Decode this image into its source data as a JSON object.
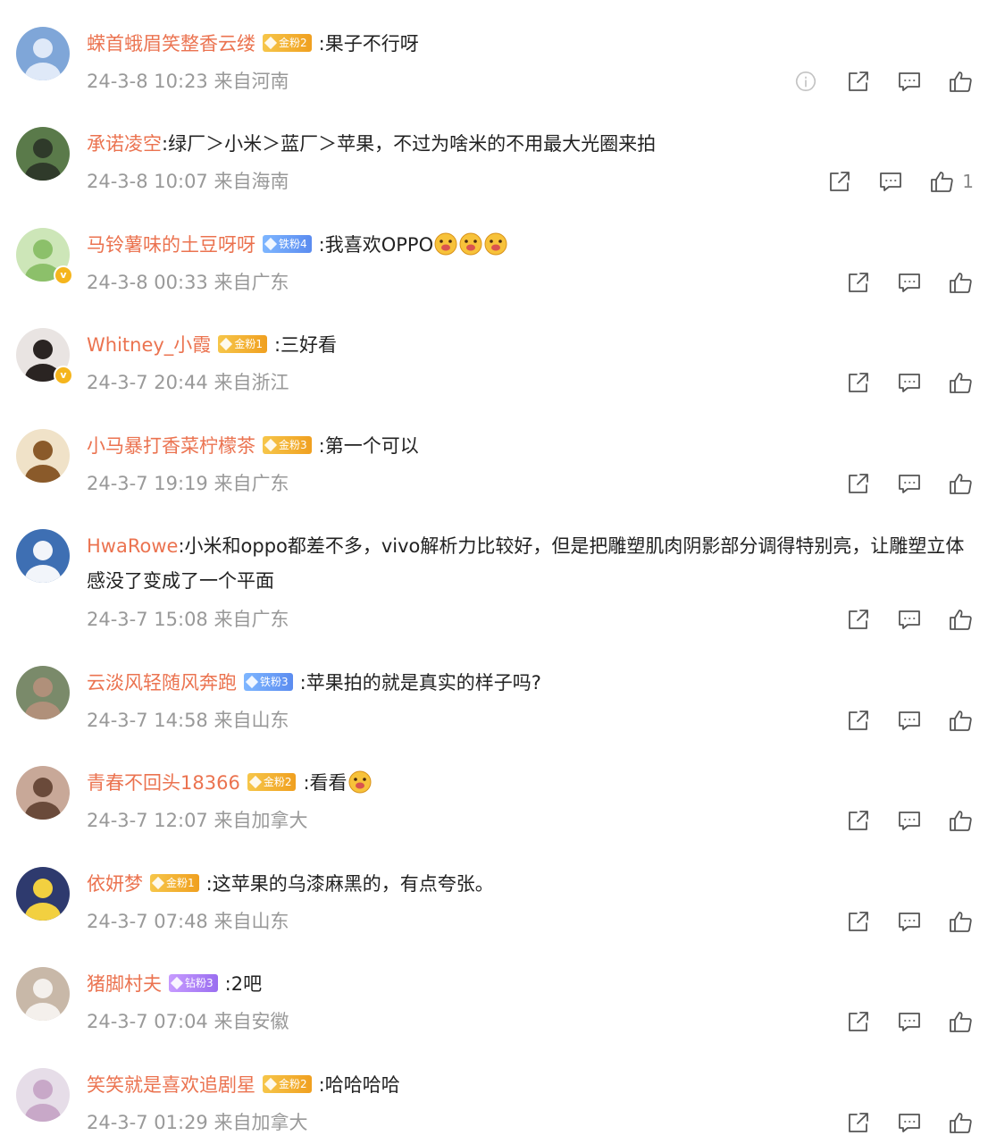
{
  "comments": [
    {
      "user": "蝾首蛾眉笑整香云缕",
      "badge": {
        "type": "gold",
        "text": "金粉2"
      },
      "text": ":果子不行呀",
      "time": "24-3-8 10:23",
      "location": "来自河南",
      "likes": "",
      "verified": false,
      "avatar": {
        "bg": "#7fa6d8",
        "fg": "#dfe9f8"
      },
      "info": true
    },
    {
      "user": "承诺凌空",
      "badge": null,
      "text": ":绿厂＞小米＞蓝厂＞苹果，不过为啥米的不用最大光圈来拍",
      "time": "24-3-8 10:07",
      "location": "来自海南",
      "likes": "1",
      "verified": false,
      "avatar": {
        "bg": "#5a7a4a",
        "fg": "#2f3a2a"
      }
    },
    {
      "user": "马铃薯味的土豆呀呀",
      "badge": {
        "type": "iron",
        "text": "铁粉4"
      },
      "text": ":我喜欢OPPO",
      "emojis": 3,
      "time": "24-3-8 00:33",
      "location": "来自广东",
      "likes": "",
      "verified": true,
      "avatar": {
        "bg": "#cde6b8",
        "fg": "#8cc06a"
      }
    },
    {
      "user": "Whitney_小霞",
      "badge": {
        "type": "gold",
        "text": "金粉1"
      },
      "text": ":三好看",
      "time": "24-3-7 20:44",
      "location": "来自浙江",
      "likes": "",
      "verified": true,
      "avatar": {
        "bg": "#e9e4e2",
        "fg": "#2a2422"
      }
    },
    {
      "user": "小马暴打香菜柠檬茶",
      "badge": {
        "type": "gold",
        "text": "金粉3"
      },
      "text": ":第一个可以",
      "time": "24-3-7 19:19",
      "location": "来自广东",
      "likes": "",
      "verified": false,
      "avatar": {
        "bg": "#f0e2c8",
        "fg": "#8a5a2a"
      }
    },
    {
      "user": "HwaRowe",
      "badge": null,
      "text": ":小米和oppo都差不多，vivo解析力比较好，但是把雕塑肌肉阴影部分调得特别亮，让雕塑立体感没了变成了一个平面",
      "time": "24-3-7 15:08",
      "location": "来自广东",
      "likes": "",
      "verified": false,
      "avatar": {
        "bg": "#3e6fb3",
        "fg": "#f2f5fa"
      }
    },
    {
      "user": "云淡风轻随风奔跑",
      "badge": {
        "type": "iron",
        "text": "铁粉3"
      },
      "text": ":苹果拍的就是真实的样子吗?",
      "time": "24-3-7 14:58",
      "location": "来自山东",
      "likes": "",
      "verified": false,
      "avatar": {
        "bg": "#7a8a6a",
        "fg": "#b0907a"
      }
    },
    {
      "user": "青春不回头18366",
      "badge": {
        "type": "gold",
        "text": "金粉2"
      },
      "text": ":看看",
      "emojis": 1,
      "time": "24-3-7 12:07",
      "location": "来自加拿大",
      "likes": "",
      "verified": false,
      "avatar": {
        "bg": "#c8a898",
        "fg": "#6a4a3a"
      }
    },
    {
      "user": "依妍梦",
      "badge": {
        "type": "gold",
        "text": "金粉1"
      },
      "text": ":这苹果的乌漆麻黑的，有点夸张。",
      "time": "24-3-7 07:48",
      "location": "来自山东",
      "likes": "",
      "verified": false,
      "avatar": {
        "bg": "#2e3a6e",
        "fg": "#f2d040"
      }
    },
    {
      "user": "猪脚村夫",
      "badge": {
        "type": "diamond",
        "text": "钻粉3"
      },
      "text": ":2吧",
      "time": "24-3-7 07:04",
      "location": "来自安徽",
      "likes": "",
      "verified": false,
      "avatar": {
        "bg": "#c8b8a8",
        "fg": "#f4f0ec"
      }
    },
    {
      "user": "笑笑就是喜欢追剧星",
      "badge": {
        "type": "gold",
        "text": "金粉2"
      },
      "text": ":哈哈哈哈",
      "time": "24-3-7 01:29",
      "location": "来自加拿大",
      "likes": "",
      "verified": false,
      "avatar": {
        "bg": "#e6dde8",
        "fg": "#c8a8c8"
      }
    }
  ]
}
